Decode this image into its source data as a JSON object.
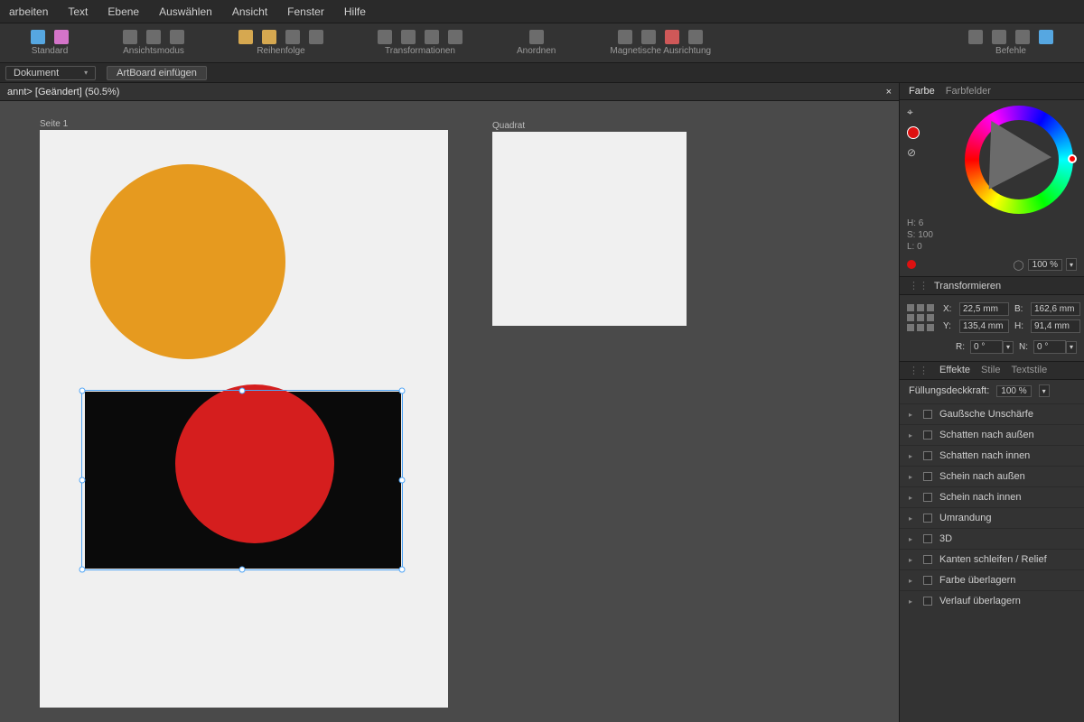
{
  "menu": {
    "items": [
      "arbeiten",
      "Text",
      "Ebene",
      "Auswählen",
      "Ansicht",
      "Fenster",
      "Hilfe"
    ]
  },
  "toolbar": {
    "groups": [
      {
        "label": "Standard"
      },
      {
        "label": "Ansichtsmodus"
      },
      {
        "label": "Reihenfolge"
      },
      {
        "label": "Transformationen"
      },
      {
        "label": "Anordnen"
      },
      {
        "label": "Magnetische Ausrichtung"
      },
      {
        "label": "Befehle"
      }
    ]
  },
  "subbar": {
    "doc_dropdown": "Dokument",
    "artboard_button": "ArtBoard einfügen"
  },
  "document_tab": {
    "title": "annt> [Geändert] (50.5%)",
    "close": "×"
  },
  "artboards": {
    "page1_label": "Seite 1",
    "quadrat_label": "Quadrat"
  },
  "color_panel": {
    "tab_color": "Farbe",
    "tab_swatches": "Farbfelder",
    "h_label": "H:",
    "h_value": "6",
    "s_label": "S:",
    "s_value": "100",
    "l_label": "L:",
    "l_value": "0",
    "opacity_value": "100 %"
  },
  "transform_panel": {
    "title": "Transformieren",
    "x_label": "X:",
    "x_value": "22,5 mm",
    "y_label": "Y:",
    "y_value": "135,4 mm",
    "w_label": "B:",
    "w_value": "162,6 mm",
    "h_label": "H:",
    "h_value": "91,4 mm",
    "r_label": "R:",
    "r_value": "0 °",
    "n_label": "N:",
    "n_value": "0 °"
  },
  "effects_panel": {
    "tab_effects": "Effekte",
    "tab_styles": "Stile",
    "tab_textstyles": "Textstile",
    "opacity_label": "Füllungsdeckkraft:",
    "opacity_value": "100 %",
    "items": [
      "Gaußsche Unschärfe",
      "Schatten nach außen",
      "Schatten nach innen",
      "Schein nach außen",
      "Schein nach innen",
      "Umrandung",
      "3D",
      "Kanten schleifen / Relief",
      "Farbe überlagern",
      "Verlauf überlagern"
    ]
  },
  "colors": {
    "orange": "#e69a1f",
    "red": "#d51e1e",
    "black": "#0a0a0a",
    "selection": "#4fa4f5"
  }
}
